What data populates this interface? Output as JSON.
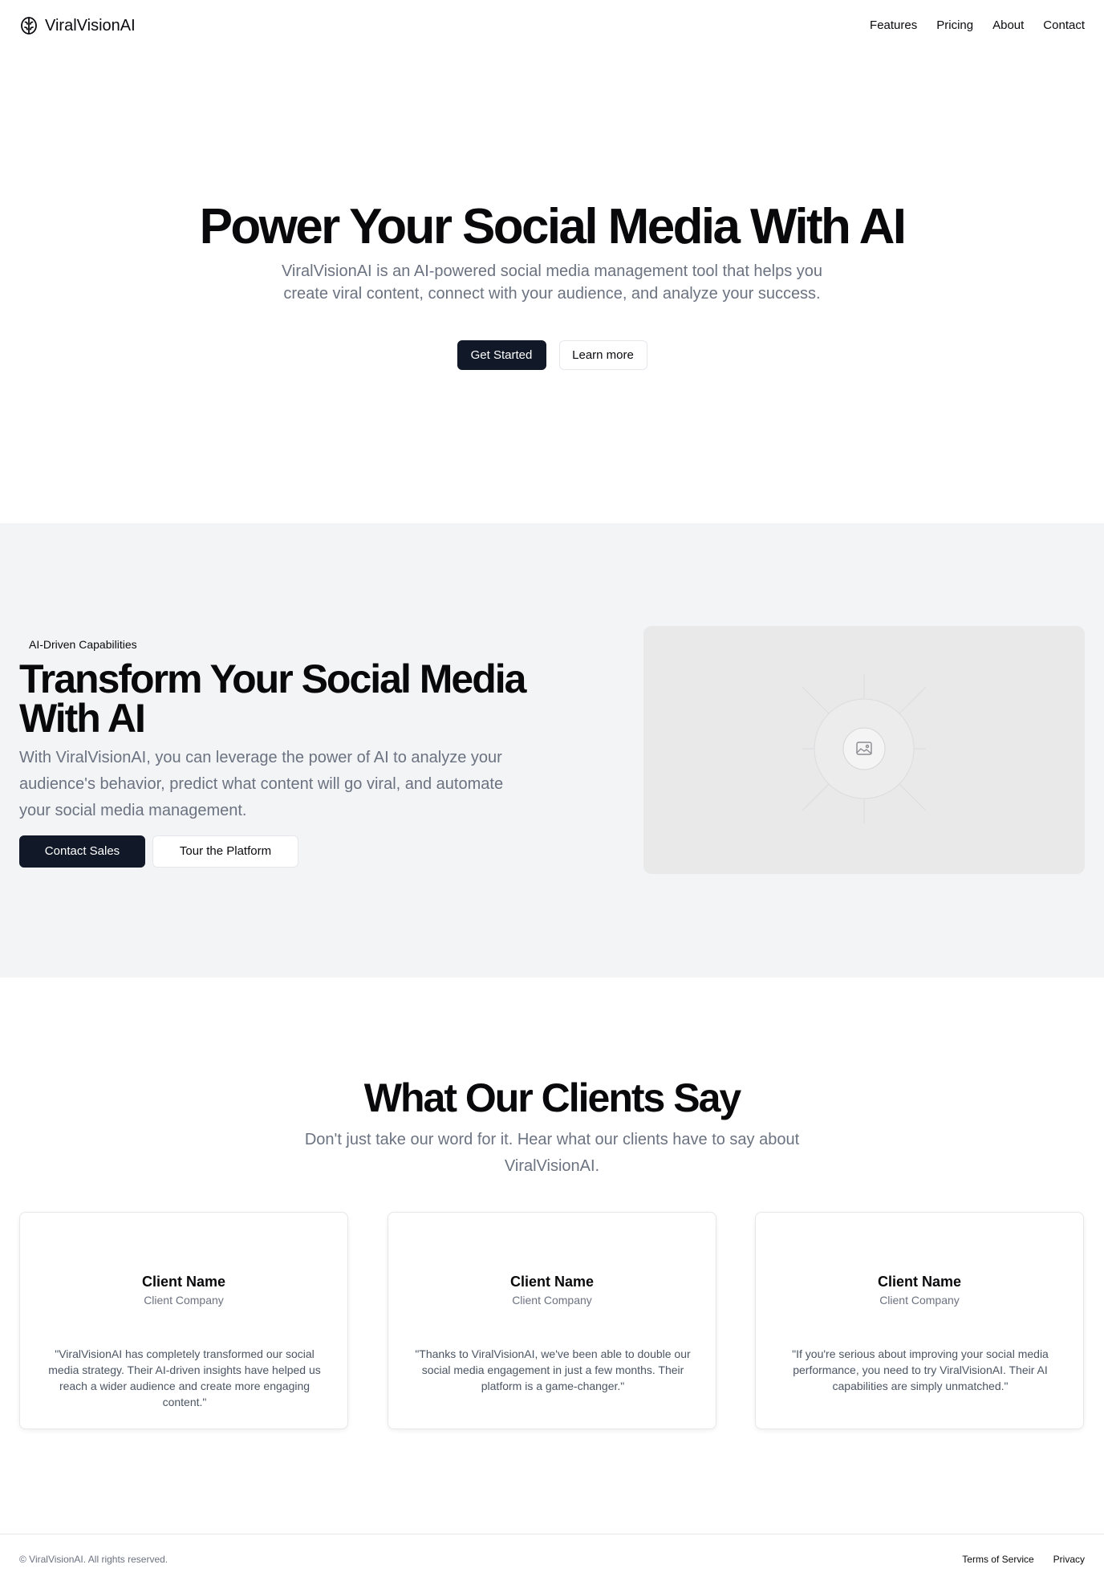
{
  "header": {
    "brand": "ViralVisionAI",
    "brand_icon": "brain-icon",
    "nav": [
      "Features",
      "Pricing",
      "About",
      "Contact"
    ]
  },
  "hero": {
    "title": "Power Your Social Media With AI",
    "subtitle": "ViralVisionAI is an AI-powered social media management tool that helps you create viral content, connect with your audience, and analyze your success.",
    "primary_cta": "Get Started",
    "secondary_cta": "Learn more"
  },
  "feature": {
    "eyebrow": "AI-Driven Capabilities",
    "title": "Transform Your Social Media With AI",
    "text": "With ViralVisionAI, you can leverage the power of AI to analyze your audience's behavior, predict what content will go viral, and automate your social media management.",
    "primary_cta": "Contact Sales",
    "secondary_cta": "Tour the Platform",
    "media_icon": "image-placeholder-icon"
  },
  "testimonials": {
    "title": "What Our Clients Say",
    "subtitle": "Don't just take our word for it. Hear what our clients have to say about ViralVisionAI.",
    "cards": [
      {
        "name": "Client Name",
        "company": "Client Company",
        "quote": "\"ViralVisionAI has completely transformed our social media strategy. Their AI-driven insights have helped us reach a wider audience and create more engaging content.\""
      },
      {
        "name": "Client Name",
        "company": "Client Company",
        "quote": "\"Thanks to ViralVisionAI, we've been able to double our social media engagement in just a few months. Their platform is a game-changer.\""
      },
      {
        "name": "Client Name",
        "company": "Client Company",
        "quote": "\"If you're serious about improving your social media performance, you need to try ViralVisionAI. Their AI capabilities are simply unmatched.\""
      }
    ]
  },
  "footer": {
    "copyright": "© ViralVisionAI. All rights reserved.",
    "links": [
      "Terms of Service",
      "Privacy"
    ]
  },
  "colors": {
    "primary_button": "#111827",
    "muted_text": "#6b7280",
    "section_background": "#f3f4f6"
  }
}
